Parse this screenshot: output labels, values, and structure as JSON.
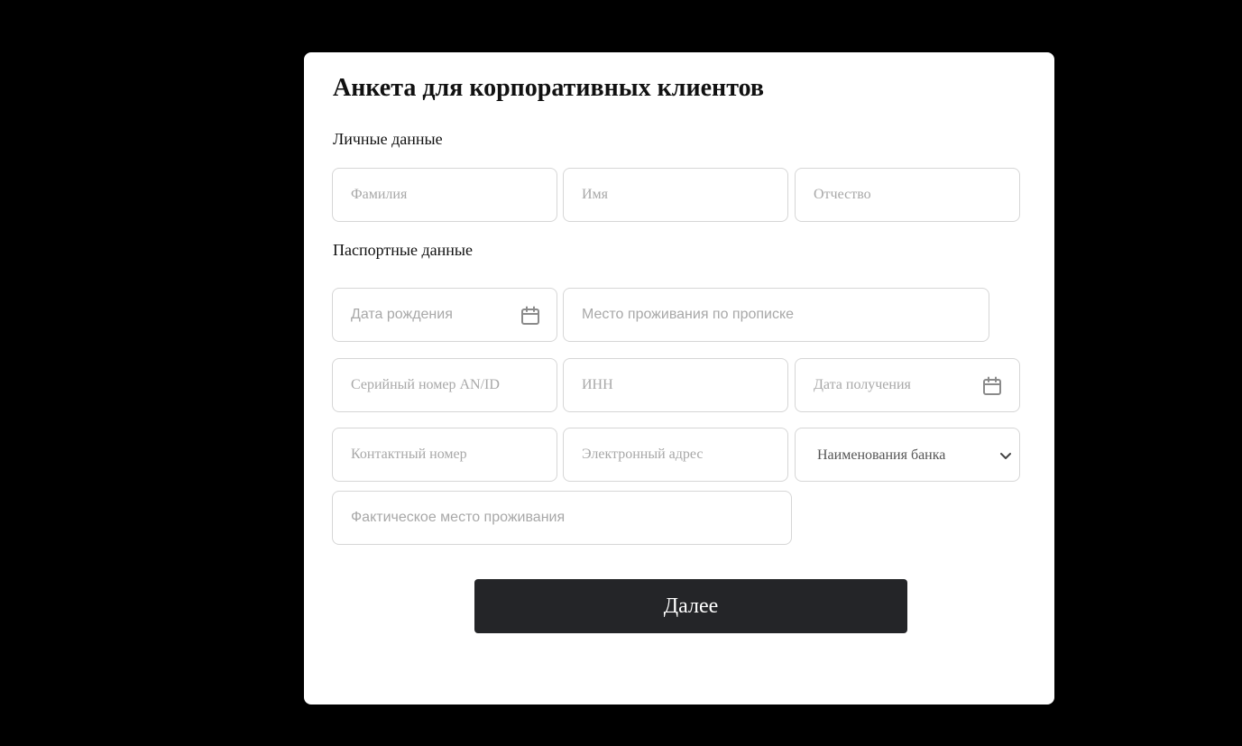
{
  "form": {
    "title": "Анкета для корпоративных клиентов",
    "sections": {
      "personal": "Личные данные",
      "passport": "Паспортные данные"
    },
    "fields": {
      "last_name": {
        "placeholder": "Фамилия",
        "value": ""
      },
      "first_name": {
        "placeholder": "Имя",
        "value": ""
      },
      "patronymic": {
        "placeholder": "Отчество",
        "value": ""
      },
      "birth_date": {
        "placeholder": "Дата рождения",
        "value": ""
      },
      "registration_address": {
        "placeholder": "Место проживания по прописке",
        "value": ""
      },
      "serial_number": {
        "placeholder": "Серийный номер AN/ID",
        "value": ""
      },
      "inn": {
        "placeholder": "ИНН",
        "value": ""
      },
      "issue_date": {
        "placeholder": "Дата получения",
        "value": ""
      },
      "contact_number": {
        "placeholder": "Контактный номер",
        "value": ""
      },
      "email": {
        "placeholder": "Электронный адрес",
        "value": ""
      },
      "bank": {
        "selected": "Наименования банка"
      },
      "actual_address": {
        "placeholder": "Фактическое место проживания",
        "value": ""
      }
    },
    "next_button": "Далее"
  },
  "icons": {
    "birth_date": "calendar-icon",
    "issue_date": "calendar-icon",
    "bank": "chevron-down-icon"
  },
  "colors": {
    "background": "#000000",
    "card": "#ffffff",
    "button": "#242528",
    "button_text": "#ffffff",
    "field_border": "#d6d6d6",
    "placeholder": "#a8a8a8"
  }
}
